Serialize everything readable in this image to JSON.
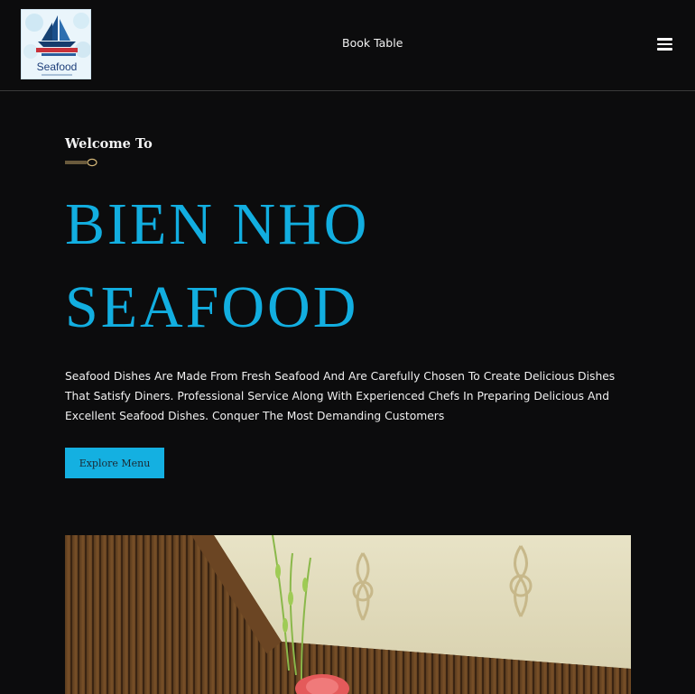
{
  "header": {
    "logo_text": "Seafood",
    "nav_book_table": "Book Table",
    "menu_icon": "hamburger-menu-icon"
  },
  "hero": {
    "kicker": "Welcome To",
    "title_line1": "BIEN NHO",
    "title_line2": "SEAFOOD",
    "description": "Seafood Dishes Are Made From Fresh Seafood And Are Carefully Chosen To Create Delicious Dishes That Satisfy Diners. Professional Service Along With Experienced Chefs In Preparing Delicious And Excellent Seafood Dishes. Conquer The Most Demanding Customers",
    "cta_label": "Explore Menu"
  },
  "colors": {
    "background": "#0c0c0d",
    "accent": "#14b0e1",
    "text": "#ffffff",
    "divider": "#3a3a3a"
  }
}
